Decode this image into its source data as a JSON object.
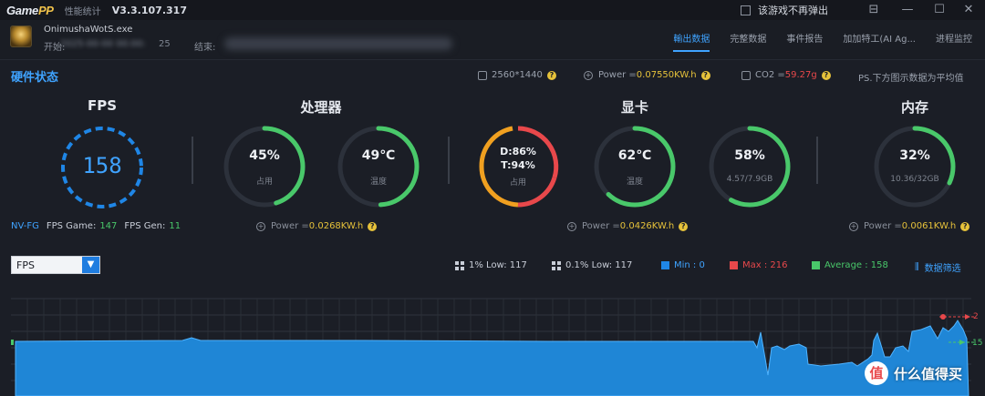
{
  "titlebar": {
    "logo_a": "Game",
    "logo_b": "PP",
    "app_name": "性能统计",
    "version": "V3.3.107.317",
    "popup_option": "该游戏不再弹出"
  },
  "session": {
    "exe": "OnimushaWotS.exe",
    "start_label": "开始:",
    "start_value": "2025-00-00 00:00:",
    "start_value_tail": "25",
    "end_label": "结束:"
  },
  "tabs": [
    {
      "label": "輸出数据",
      "active": true
    },
    {
      "label": "完整数据",
      "active": false
    },
    {
      "label": "事件报告",
      "active": false
    },
    {
      "label": "加加特工(AI Ag...",
      "active": false
    },
    {
      "label": "进程监控",
      "active": false
    }
  ],
  "status": {
    "title": "硬件状态",
    "resolution": "2560*1440",
    "power_label": "Power = ",
    "power_value": "0.07550KW.h",
    "co2_label": "CO2 = ",
    "co2_value": "59.27g",
    "note": "PS.下方图示数据为平均值"
  },
  "sections": {
    "fps": "FPS",
    "cpu": "处理器",
    "gpu": "显卡",
    "mem": "内存"
  },
  "fps_gauge": {
    "value": "158"
  },
  "fps_details": {
    "nvfg": "NV-FG",
    "game_label": "FPS Game:",
    "game_value": "147",
    "gen_label": "FPS Gen:",
    "gen_value": "11"
  },
  "cpu": {
    "usage": {
      "value": "45%",
      "sub": "占用",
      "fraction": 0.45
    },
    "temp": {
      "value": "49℃",
      "sub": "温度",
      "fraction": 0.49
    },
    "power_label": "Power = ",
    "power_value": "0.0268KW.h"
  },
  "gpu": {
    "usage": {
      "line1": "D:86%",
      "line2": "T:94%",
      "sub": "占用"
    },
    "temp": {
      "value": "62℃",
      "sub": "温度",
      "fraction": 0.62
    },
    "vram": {
      "value": "58%",
      "sub": "4.57/7.9GB",
      "fraction": 0.58
    },
    "power_label": "Power = ",
    "power_value": "0.0426KW.h"
  },
  "mem": {
    "usage": {
      "value": "32%",
      "sub": "10.36/32GB",
      "fraction": 0.32
    },
    "power_label": "Power = ",
    "power_value": "0.0061KW.h"
  },
  "graph_controls": {
    "metric": "FPS",
    "low1": "1% Low: 117",
    "low01": "0.1% Low: 117",
    "min": "Min : 0",
    "max": "Max : 216",
    "avg": "Average : 158",
    "filter": "数据筛选"
  },
  "graph_edge_labels": {
    "max_tick": "2",
    "avg_tick": "15"
  },
  "watermark": {
    "badge": "值",
    "text": "什么值得买"
  },
  "colors": {
    "accent": "#3fa3ff",
    "green": "#49c86a",
    "red": "#e8484b",
    "yellow": "#e6c23a",
    "orange": "#f0a020",
    "graph_fill": "#1f86d6"
  }
}
